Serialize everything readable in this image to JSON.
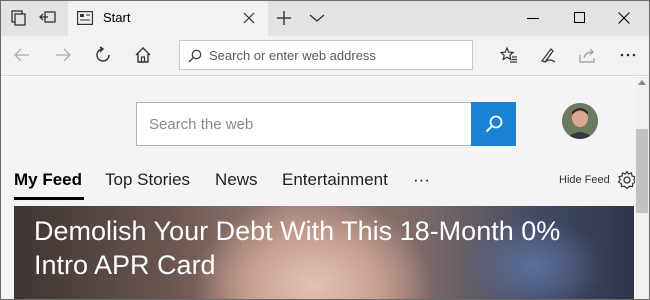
{
  "tab": {
    "title": "Start"
  },
  "address_bar": {
    "placeholder": "Search or enter web address"
  },
  "search": {
    "placeholder": "Search the web"
  },
  "feed": {
    "tabs": [
      "My Feed",
      "Top Stories",
      "News",
      "Entertainment",
      "···"
    ],
    "active_tab": "My Feed",
    "hide_feed_label": "Hide Feed"
  },
  "hero": {
    "headline": "Demolish Your Debt With This 18-Month 0% Intro APR Card"
  },
  "colors": {
    "accent": "#1a82d4",
    "titlebar": "#e3e3e3",
    "tab_active": "#f2f2f2"
  },
  "icons": {
    "titlebar": [
      "tab-list-icon",
      "set-aside-tabs-icon"
    ],
    "nav": [
      "back-icon",
      "forward-icon",
      "refresh-icon",
      "home-icon"
    ],
    "toolbar": [
      "favorites-icon",
      "pen-icon",
      "share-icon",
      "more-icon"
    ],
    "window": [
      "minimize-icon",
      "maximize-icon",
      "close-icon"
    ]
  }
}
